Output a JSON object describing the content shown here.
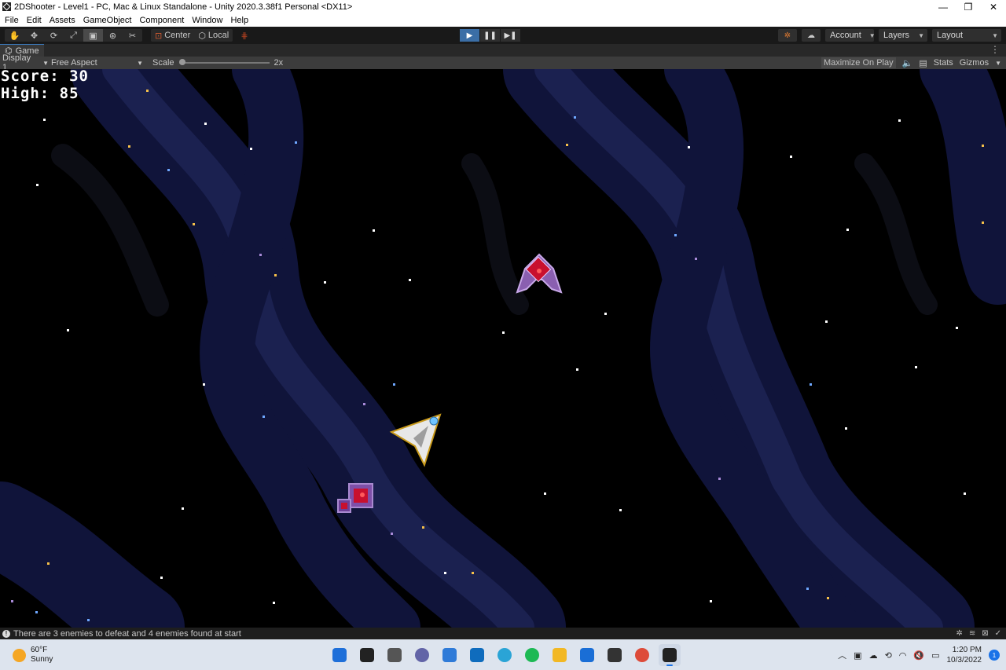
{
  "window": {
    "title": "2DShooter - Level1 - PC, Mac & Linux Standalone - Unity 2020.3.38f1 Personal <DX11>",
    "controls": [
      "—",
      "❐",
      "✕"
    ]
  },
  "menu": [
    "File",
    "Edit",
    "Assets",
    "GameObject",
    "Component",
    "Window",
    "Help"
  ],
  "toolbar": {
    "tools": [
      "hand-tool",
      "move-tool",
      "rotate-tool",
      "scale-tool",
      "rect-tool",
      "transform-tool",
      "custom-tool"
    ],
    "active_tool_index": 4,
    "pivot_label": "Center",
    "space_label": "Local",
    "play_active": true,
    "account_label": "Account",
    "layers_label": "Layers",
    "layout_label": "Layout"
  },
  "game_tab": {
    "label": "Game"
  },
  "game_view": {
    "display_label": "Display 1",
    "aspect_label": "Free Aspect",
    "scale_label": "Scale",
    "scale_value": "2x",
    "maximize_label": "Maximize On Play",
    "stats_label": "Stats",
    "gizmos_label": "Gizmos"
  },
  "hud": {
    "score_text": "Score: 30",
    "high_text": "High: 85"
  },
  "status": {
    "message": "There are 3 enemies to defeat and 4 enemies found at start"
  },
  "taskbar": {
    "weather_temp": "60°F",
    "weather_desc": "Sunny",
    "time": "1:20 PM",
    "date": "10/3/2022",
    "notification_count": "1",
    "apps": [
      "start",
      "search",
      "task-view",
      "chat",
      "store",
      "mail",
      "browser",
      "spotify",
      "file-explorer",
      "calendar",
      "unity-hub",
      "chrome",
      "unity-editor"
    ],
    "app_colors": [
      "#1e6fd9",
      "#222222",
      "#555555",
      "#6264a7",
      "#2f7bd8",
      "#0f6cbd",
      "#2aa4d6",
      "#1db954",
      "#f2b824",
      "#1a6ed6",
      "#333333",
      "#dd4b39",
      "#222222"
    ],
    "active_app_index": 12
  },
  "colors": {
    "accent": "#3b6ea6",
    "nebula_dark": "#121536",
    "nebula_band": "#1c2250"
  }
}
